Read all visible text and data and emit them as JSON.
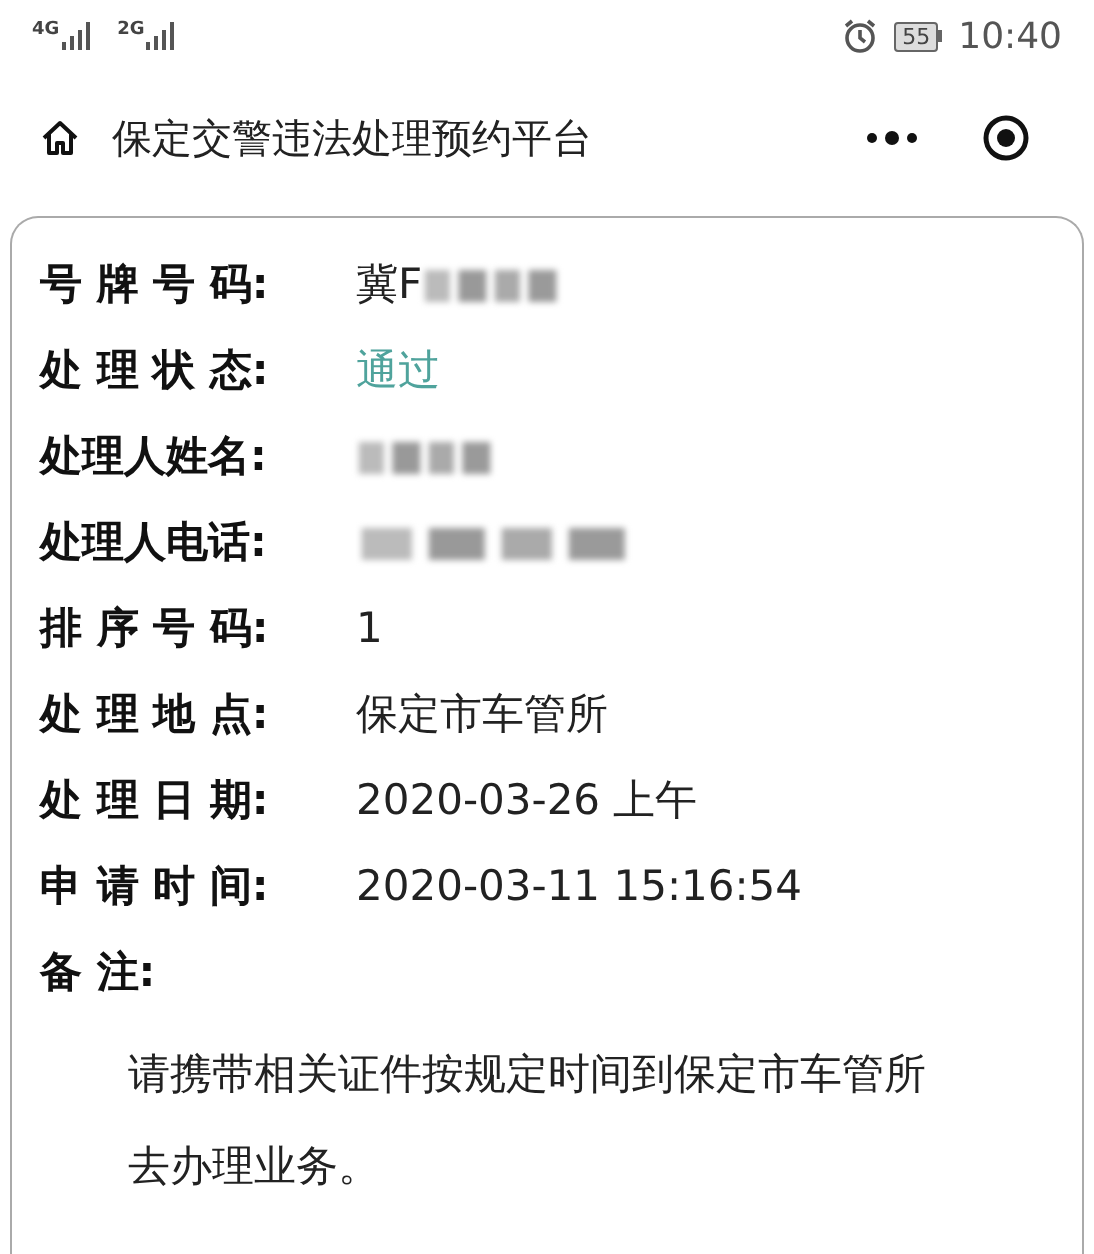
{
  "status_bar": {
    "signal_1": "4G",
    "signal_2": "2G",
    "battery": "55",
    "time": "10:40"
  },
  "nav": {
    "title": "保定交警违法处理预约平台"
  },
  "details": [
    {
      "label": "号 牌 号 码:",
      "kind": "plain",
      "value": "冀F",
      "redacted": true
    },
    {
      "label": "处 理 状 态:",
      "kind": "status",
      "value": "通过"
    },
    {
      "label": "处理人姓名:",
      "redacted": true
    },
    {
      "label": "处理人电话:",
      "redacted": true
    },
    {
      "label": "排 序 号 码:",
      "kind": "plain",
      "value": "1"
    },
    {
      "label": "处 理 地 点:",
      "kind": "plain",
      "value": "保定市车管所"
    },
    {
      "label": "处 理 日 期:",
      "kind": "plain",
      "value": "2020-03-26 上午"
    },
    {
      "label": "申 请 时 间:",
      "kind": "plain",
      "value": "2020-03-11 15:16:54"
    }
  ],
  "remark": {
    "label": "备 注:",
    "text": "请携带相关证件按规定时间到保定市车管所去办理业务。"
  }
}
